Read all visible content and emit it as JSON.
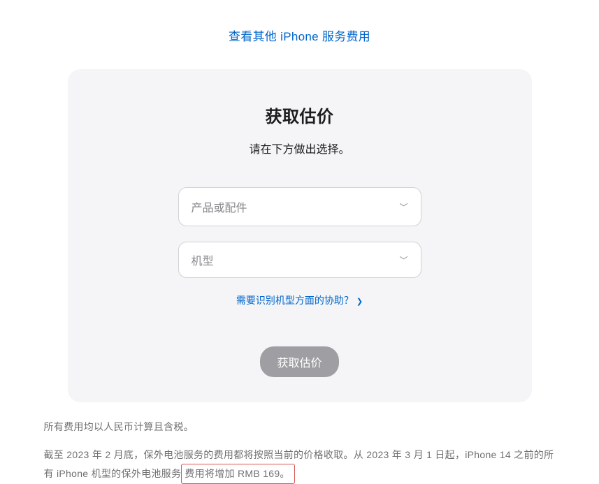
{
  "topLink": "查看其他 iPhone 服务费用",
  "card": {
    "title": "获取估价",
    "subtitle": "请在下方做出选择。",
    "select1": "产品或配件",
    "select2": "机型",
    "helpLink": "需要识别机型方面的协助？",
    "submit": "获取估价"
  },
  "footer": {
    "line1": "所有费用均以人民币计算且含税。",
    "line2_prefix": "截至 2023 年 2 月底，保外电池服务的费用都将按照当前的价格收取。从 2023 年 3 月 1 日起，iPhone 14 之前的所有 iPhone 机型的保外电池服务",
    "line2_highlight": "费用将增加 RMB 169。"
  }
}
